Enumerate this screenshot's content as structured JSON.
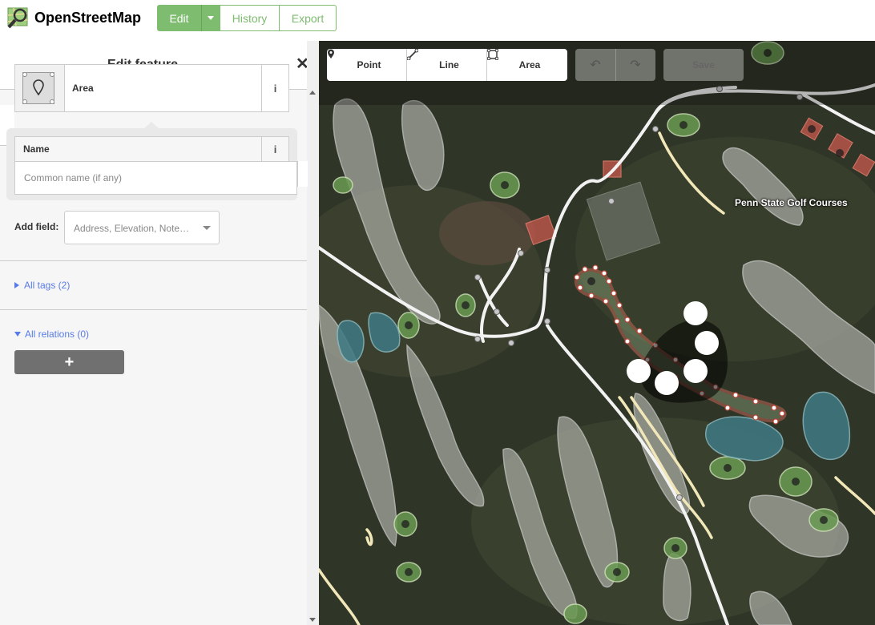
{
  "app": {
    "name": "OpenStreetMap"
  },
  "nav": {
    "edit": "Edit",
    "history": "History",
    "export": "Export"
  },
  "panel": {
    "title": "Edit feature",
    "preset_label": "Area",
    "info_glyph": "i",
    "name_label": "Name",
    "name_placeholder": "Common name (if any)",
    "add_field_label": "Add field:",
    "add_field_placeholder": "Address, Elevation, Note…",
    "all_tags": "All tags (2)",
    "all_relations": "All relations (0)",
    "add_relation": "+"
  },
  "toolbar": {
    "point": "Point",
    "line": "Line",
    "area": "Area",
    "save": "Save"
  },
  "map": {
    "place_label": "Penn State Golf Courses"
  },
  "colors": {
    "accent": "#7ebc6f",
    "link": "#597be7",
    "selected_outline": "#e06e5f"
  }
}
